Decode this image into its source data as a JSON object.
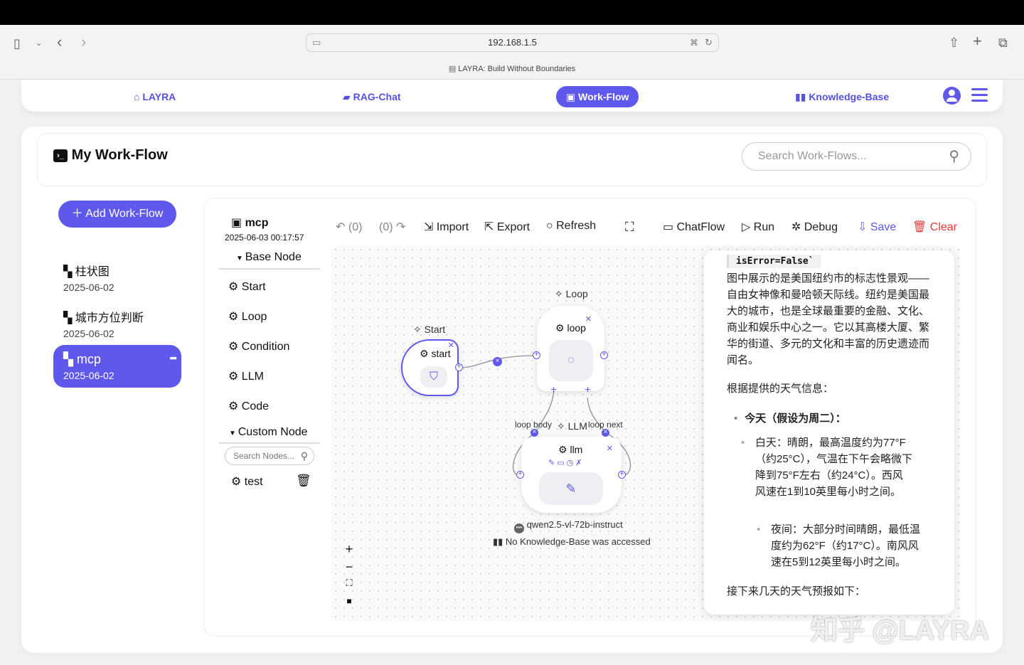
{
  "browser": {
    "url": "192.168.1.5",
    "tab_title": "LAYRA: Build Without Boundaries"
  },
  "nav": {
    "home": "LAYRA",
    "rag_chat": "RAG-Chat",
    "work_flow": "Work-Flow",
    "knowledge_base": "Knowledge-Base"
  },
  "page": {
    "title": "My Work-Flow",
    "search_placeholder": "Search Work-Flows...",
    "add_button": "Add Work-Flow"
  },
  "workflows": [
    {
      "name": "柱状图",
      "date": "2025-06-02"
    },
    {
      "name": "城市方位判断",
      "date": "2025-06-02"
    },
    {
      "name": "mcp",
      "date": "2025-06-02",
      "menu": "•••"
    }
  ],
  "editor": {
    "name": "mcp",
    "timestamp": "2025-06-03 00:17:57",
    "base_node_header": "Base Node",
    "base_nodes": [
      "Start",
      "Loop",
      "Condition",
      "LLM",
      "Code"
    ],
    "custom_node_header": "Custom Node",
    "search_nodes_placeholder": "Search Nodes...",
    "custom_nodes": [
      "test"
    ]
  },
  "toolbar": {
    "undo": "(0)",
    "redo": "(0)",
    "import": "Import",
    "export": "Export",
    "refresh": "Refresh",
    "chatflow": "ChatFlow",
    "run": "Run",
    "debug": "Debug",
    "save": "Save",
    "clear": "Clear"
  },
  "canvas": {
    "start_group": "Start",
    "start_node": "start",
    "loop_group": "Loop",
    "loop_node": "loop",
    "llm_group": "LLM",
    "llm_node": "llm",
    "loop_body": "loop body",
    "loop_next": "loop next",
    "model": "qwen2.5-vl-72b-instruct",
    "kb_status": "No Knowledge-Base was accessed"
  },
  "chat": {
    "code": "isError=False`",
    "p1": "图中展示的是美国纽约市的标志性景观——自由女神像和曼哈顿天际线。纽约是美国最大的城市，也是全球最重要的金融、文化、商业和娱乐中心之一。它以其高楼大厦、繁华的街道、多元的文化和丰富的历史遗迹而闻名。",
    "p2": "根据提供的天气信息：",
    "today": "今天（假设为周二）：",
    "day": "白天：晴朗，最高温度约为77°F（约25°C），气温在下午会略微下降到75°F左右（约24°C）。西风风速在1到10英里每小时之间。",
    "night": "夜间：大部分时间晴朗，最低温度约为62°F（约17°C）。南风风速在5到12英里每小时之间。",
    "p3": "接下来几天的天气预报如下："
  },
  "watermark": "知乎 @LAYRA",
  "colors": {
    "accent": "#5f58ec",
    "clear": "#e53935",
    "save": "#5f58ec"
  }
}
